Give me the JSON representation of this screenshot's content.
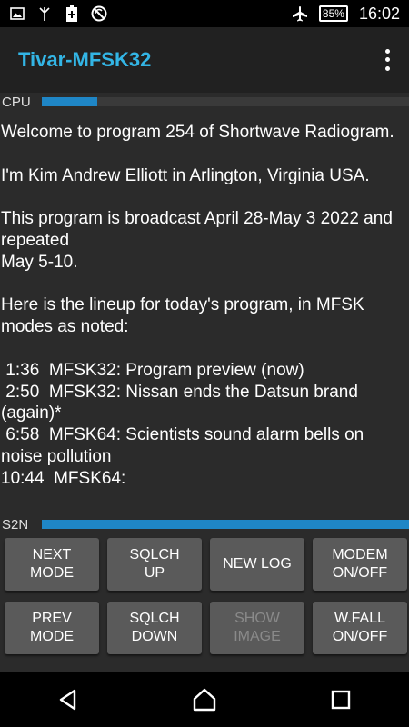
{
  "status_bar": {
    "icons_left": [
      "image-icon",
      "antenna-icon",
      "battery-saver-icon",
      "no-sync-icon"
    ],
    "icons_right": [
      "airplane-icon"
    ],
    "battery": "85%",
    "time": "16:02"
  },
  "app_bar": {
    "title": "Tivar-MFSK32",
    "menu_icon": "overflow-menu-icon"
  },
  "cpu_meter": {
    "label": "CPU",
    "level": 0.15
  },
  "log": {
    "text": "Welcome to program 254 of Shortwave Radiogram.\n\nI'm Kim Andrew Elliott in Arlington, Virginia USA.\n\nThis program is broadcast April 28-May 3 2022 and repeated\nMay 5-10.\n\nHere is the lineup for today's program, in MFSK modes as noted:\n\n 1:36  MFSK32: Program preview (now)\n 2:50  MFSK32: Nissan ends the Datsun brand (again)*\n 6:58  MFSK64: Scientists sound alarm bells on noise pollution\n10:44  MFSK64:"
  },
  "s2n_meter": {
    "label": "S2N",
    "level": 1.0
  },
  "buttons": [
    {
      "label": "NEXT\nMODE",
      "enabled": true
    },
    {
      "label": "SQLCH\nUP",
      "enabled": true
    },
    {
      "label": "NEW LOG",
      "enabled": true
    },
    {
      "label": "MODEM\nON/OFF",
      "enabled": true
    },
    {
      "label": "PREV\nMODE",
      "enabled": true
    },
    {
      "label": "SQLCH\nDOWN",
      "enabled": true
    },
    {
      "label": "SHOW\nIMAGE",
      "enabled": false
    },
    {
      "label": "W.FALL\nON/OFF",
      "enabled": true
    }
  ],
  "nav_bar": {
    "icons": [
      "back-icon",
      "home-icon",
      "recents-icon"
    ]
  },
  "colors": {
    "accent": "#33b5e5",
    "meter": "#1f86c6",
    "button": "#5a5a5a"
  }
}
